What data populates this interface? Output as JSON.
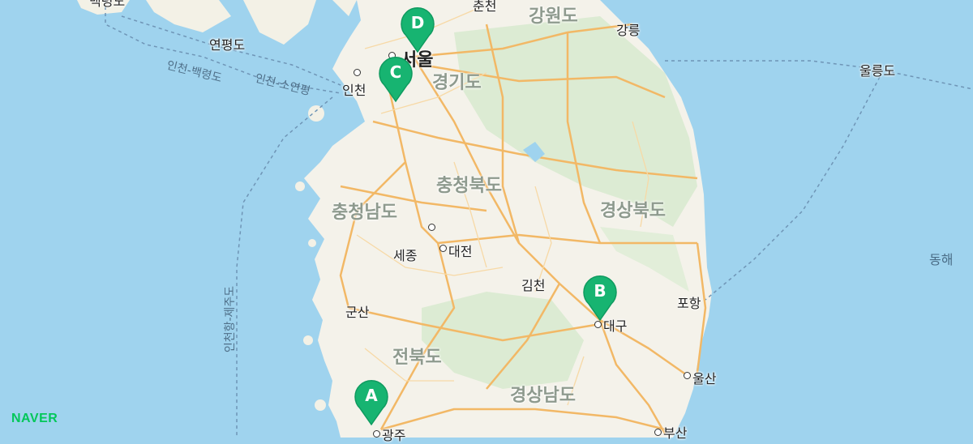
{
  "logo": "NAVER",
  "provinces": {
    "gangwon": "강원도",
    "gyeonggi": "경기도",
    "chungbuk": "충청북도",
    "chungnam": "충청남도",
    "gyeongbuk": "경상북도",
    "jeonbuk": "전북도",
    "gyeongnam": "경상남도"
  },
  "cities": {
    "seoul": "서울",
    "incheon": "인천",
    "chuncheon": "춘천",
    "gangneung": "강릉",
    "sejong": "세종",
    "daejeon": "대전",
    "gimcheon": "김천",
    "pohang": "포항",
    "daegu": "대구",
    "gunsan": "군산",
    "ulsan": "울산",
    "gwangju": "광주",
    "busan": "부산"
  },
  "islands": {
    "yeonpyeong": "연평도",
    "ulleung": "울릉도",
    "topleft": "백령도"
  },
  "sea": {
    "east": "동해"
  },
  "routes": {
    "incheon_baengnyeong": "인천-백령도",
    "incheon_soyeonpyeong": "인천-소연평",
    "incheon_jeju": "인천항-제주도"
  },
  "markers": [
    {
      "letter": "D",
      "color": "#17b471"
    },
    {
      "letter": "C",
      "color": "#17b471"
    },
    {
      "letter": "B",
      "color": "#17b471"
    },
    {
      "letter": "A",
      "color": "#17b471"
    }
  ]
}
